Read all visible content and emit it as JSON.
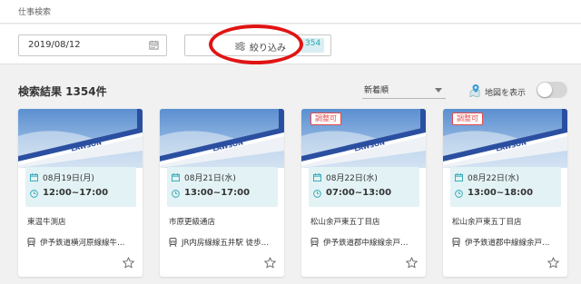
{
  "breadcrumb": "仕事検索",
  "filter": {
    "date_value": "2019/08/12",
    "narrow_label": "絞り込み",
    "count_badge": "354"
  },
  "results": {
    "title": "検索結果 1354件",
    "sort_value": "新着順",
    "map_label": "地図を表示",
    "map_enabled": false
  },
  "colors": {
    "accent": "#2aa7b5",
    "annotation_red": "#e11414",
    "badge_red": "#e24b4b",
    "schedule_bg": "#e3f2f5"
  },
  "cards": [
    {
      "badge": "",
      "date": "08月19日(月)",
      "time": "12:00~17:00",
      "store": "東温牛渕店",
      "station": "伊予鉄道横河原線線牛…",
      "image_sign": "LAWSON"
    },
    {
      "badge": "",
      "date": "08月21日(水)",
      "time": "13:00~17:00",
      "store": "市原更級通店",
      "station": "JR内房線線五井駅 徒歩…",
      "image_sign": "LAWSON"
    },
    {
      "badge": "調整可",
      "date": "08月22日(水)",
      "time": "07:00~13:00",
      "store": "松山余戸東五丁目店",
      "station": "伊予鉄道郡中線線余戸…",
      "image_sign": "LAWSON"
    },
    {
      "badge": "調整可",
      "date": "08月22日(水)",
      "time": "13:00~18:00",
      "store": "松山余戸東五丁目店",
      "station": "伊予鉄道郡中線線余戸…",
      "image_sign": "LAWSON"
    }
  ]
}
